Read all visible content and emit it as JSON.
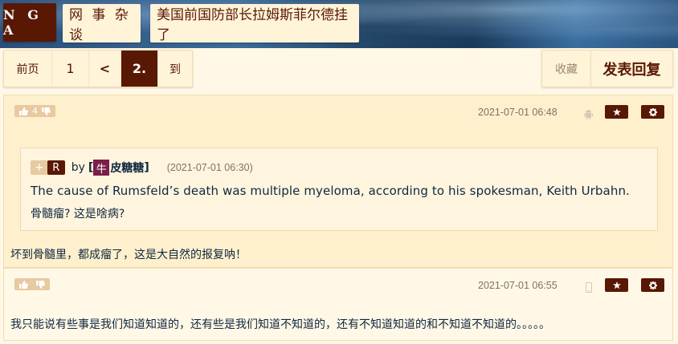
{
  "header": {
    "logo": "N G A",
    "forum": "网 事 杂 谈",
    "topic": "美国前国防部长拉姆斯菲尔德挂了"
  },
  "pager": {
    "prev": "前页",
    "page1": "1",
    "back": "<",
    "current": "2.",
    "goto": "到"
  },
  "actions": {
    "favorite": "收藏",
    "reply": "发表回复"
  },
  "posts": [
    {
      "votes": "4",
      "date": "2021-07-01 06:48",
      "device_icon": "android-icon",
      "quote": {
        "plus": "+",
        "r": "R",
        "by": "by",
        "bracket_open": "[",
        "user_badge": "牛",
        "user_rest": "皮糖糖",
        "bracket_close": "]",
        "time": "(2021-07-01 06:30)",
        "line1": "The cause of Rumsfeld’s death was multiple myeloma, according to his spokesman, Keith Urbahn.",
        "line2": "骨髓瘤? 这是啥病?"
      },
      "body": "坏到骨髓里，都成瘤了，这是大自然的报复呐！"
    },
    {
      "votes": "",
      "date": "2021-07-01 06:55",
      "device_icon": "phone-icon",
      "body": "我只能说有些事是我们知道知道的，还有些是我们知道不知道的，还有不知道知道的和不知道不知道的。。。。。"
    }
  ]
}
